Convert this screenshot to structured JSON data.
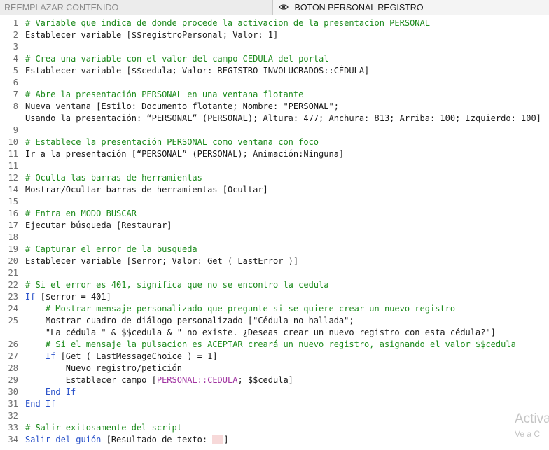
{
  "tabs": {
    "left": "REEMPLAZAR CONTENIDO",
    "right": "BOTON PERSONAL REGISTRO",
    "right_icon": "eye-icon"
  },
  "colors": {
    "comment": "#1c8a1c",
    "keyword": "#2a52c9",
    "field": "#a032a0",
    "line_number": "#6c6c6c"
  },
  "script": [
    {
      "n": "1",
      "segs": [
        {
          "c": "cm",
          "t": "# Variable que indica de donde procede la activacion de la presentacion PERSONAL"
        }
      ]
    },
    {
      "n": "2",
      "segs": [
        {
          "c": "",
          "t": "Establecer variable [$$registroPersonal; Valor: 1]"
        }
      ]
    },
    {
      "n": "3",
      "segs": []
    },
    {
      "n": "4",
      "segs": [
        {
          "c": "cm",
          "t": "# Crea una variable con el valor del campo CEDULA del portal"
        }
      ]
    },
    {
      "n": "5",
      "segs": [
        {
          "c": "",
          "t": "Establecer variable [$$cedula; Valor: REGISTRO INVOLUCRADOS::CÉDULA]"
        }
      ]
    },
    {
      "n": "6",
      "segs": []
    },
    {
      "n": "7",
      "segs": [
        {
          "c": "cm",
          "t": "# Abre la presentación PERSONAL en una ventana flotante"
        }
      ]
    },
    {
      "n": "8",
      "segs": [
        {
          "c": "",
          "t": "Nueva ventana [Estilo: Documento flotante; Nombre: \"PERSONAL\";"
        }
      ]
    },
    {
      "n": "",
      "segs": [
        {
          "c": "",
          "t": "Usando la presentación: “PERSONAL” (PERSONAL); Altura: 477; Anchura: 813; Arriba: 100; Izquierdo: 100]"
        }
      ]
    },
    {
      "n": "9",
      "segs": []
    },
    {
      "n": "10",
      "segs": [
        {
          "c": "cm",
          "t": "# Establece la presentación PERSONAL como ventana con foco"
        }
      ]
    },
    {
      "n": "11",
      "segs": [
        {
          "c": "",
          "t": "Ir a la presentación [“PERSONAL” (PERSONAL); Animación:Ninguna]"
        }
      ]
    },
    {
      "n": "11",
      "segs": []
    },
    {
      "n": "12",
      "segs": [
        {
          "c": "cm",
          "t": "# Oculta las barras de herramientas"
        }
      ]
    },
    {
      "n": "14",
      "segs": [
        {
          "c": "",
          "t": "Mostrar/Ocultar barras de herramientas [Ocultar]"
        }
      ]
    },
    {
      "n": "15",
      "segs": []
    },
    {
      "n": "16",
      "segs": [
        {
          "c": "cm",
          "t": "# Entra en MODO BUSCAR"
        }
      ]
    },
    {
      "n": "17",
      "segs": [
        {
          "c": "",
          "t": "Ejecutar búsqueda [Restaurar]"
        }
      ]
    },
    {
      "n": "18",
      "segs": []
    },
    {
      "n": "19",
      "segs": [
        {
          "c": "cm",
          "t": "# Capturar el error de la busqueda"
        }
      ]
    },
    {
      "n": "20",
      "segs": [
        {
          "c": "",
          "t": "Establecer variable [$error; Valor: Get ( LastError )]"
        }
      ]
    },
    {
      "n": "21",
      "segs": []
    },
    {
      "n": "22",
      "segs": [
        {
          "c": "cm",
          "t": "# Si el error es 401, significa que no se encontro la cedula"
        }
      ]
    },
    {
      "n": "23",
      "segs": [
        {
          "c": "kw",
          "t": "If"
        },
        {
          "c": "",
          "t": " [$error = 401]"
        }
      ]
    },
    {
      "n": "24",
      "segs": [
        {
          "c": "cm",
          "t": "    # Mostrar mensaje personalizado que pregunte si se quiere crear un nuevo registro"
        }
      ]
    },
    {
      "n": "25",
      "segs": [
        {
          "c": "",
          "t": "    Mostrar cuadro de diálogo personalizado [\"Cédula no hallada\";"
        }
      ]
    },
    {
      "n": "",
      "segs": [
        {
          "c": "",
          "t": "    \"La cédula \" & $$cedula & \" no existe. ¿Deseas crear un nuevo registro con esta cédula?\"]"
        }
      ]
    },
    {
      "n": "26",
      "segs": [
        {
          "c": "cm",
          "t": "    # Si el mensaje la pulsacion es ACEPTAR creará un nuevo registro, asignando el valor $$cedula"
        }
      ]
    },
    {
      "n": "27",
      "segs": [
        {
          "c": "kw",
          "t": "    If"
        },
        {
          "c": "",
          "t": " [Get ( LastMessageChoice ) = 1]"
        }
      ]
    },
    {
      "n": "28",
      "segs": [
        {
          "c": "",
          "t": "        Nuevo registro/petición"
        }
      ]
    },
    {
      "n": "29",
      "segs": [
        {
          "c": "",
          "t": "        Establecer campo ["
        },
        {
          "c": "fld",
          "t": "PERSONAL::CEDULA"
        },
        {
          "c": "",
          "t": "; $$cedula]"
        }
      ]
    },
    {
      "n": "30",
      "segs": [
        {
          "c": "kw",
          "t": "    End If"
        }
      ]
    },
    {
      "n": "31",
      "segs": [
        {
          "c": "kw",
          "t": "End If"
        }
      ]
    },
    {
      "n": "32",
      "segs": []
    },
    {
      "n": "33",
      "segs": [
        {
          "c": "cm",
          "t": "# Salir exitosamente del script"
        }
      ]
    },
    {
      "n": "34",
      "segs": [
        {
          "c": "kw",
          "t": "Salir del guión"
        },
        {
          "c": "",
          "t": " [Resultado de texto: "
        },
        {
          "c": "hl",
          "t": ""
        },
        {
          "c": "",
          "t": "]"
        }
      ]
    }
  ],
  "watermark": {
    "title": "Activa",
    "subtitle": "Ve a C"
  }
}
